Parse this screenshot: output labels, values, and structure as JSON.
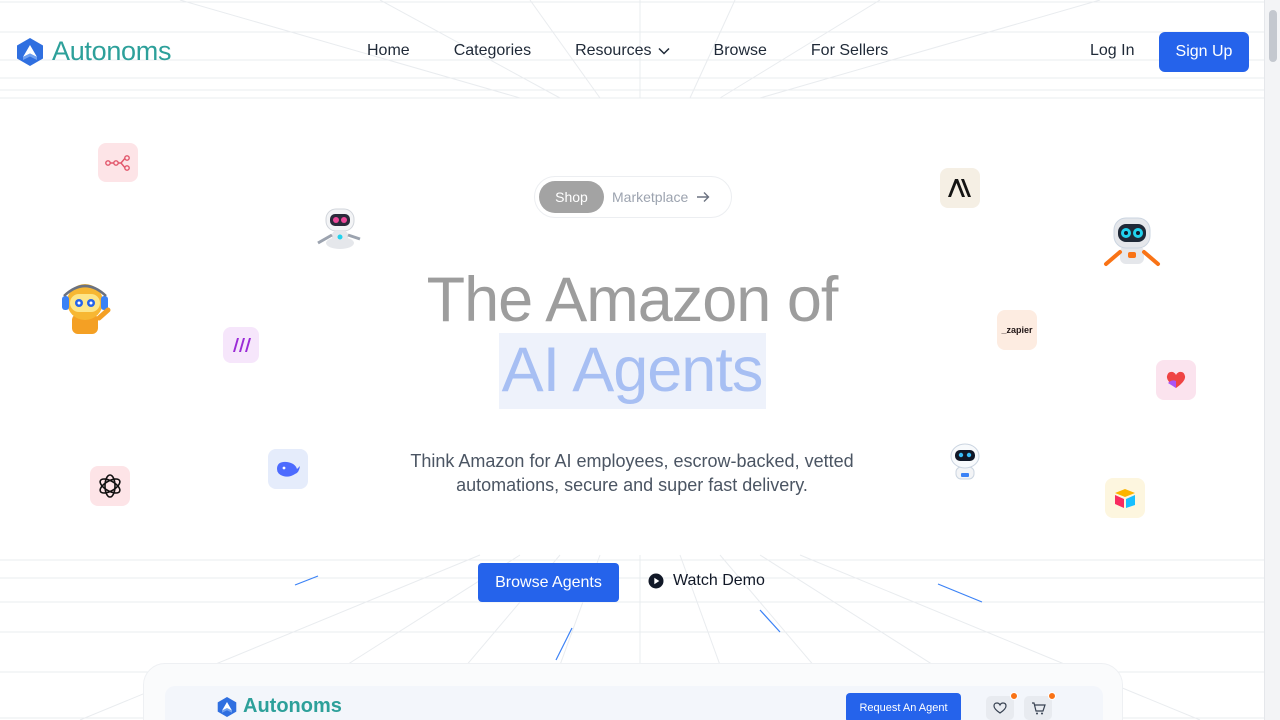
{
  "brand": {
    "name": "Autonoms"
  },
  "nav": {
    "links": [
      "Home",
      "Categories",
      "Resources",
      "Browse",
      "For Sellers"
    ],
    "login": "Log In",
    "signup": "Sign Up"
  },
  "pill": {
    "active": "Shop",
    "other": "Marketplace"
  },
  "hero": {
    "line1": "The Amazon of",
    "line2": "AI Agents",
    "subtitle_line1": "Think Amazon for AI employees, escrow-backed, vetted",
    "subtitle_line2": "automations, secure and super fast delivery."
  },
  "cta": {
    "primary": "Browse Agents",
    "secondary": "Watch Demo"
  },
  "floating_icons": [
    "workflow-icon",
    "robot-pink-icon",
    "robot-yellow-icon",
    "make-icon",
    "openai-icon",
    "deepseek-icon",
    "anthropic-icon",
    "robot-blue-icon",
    "zapier-icon",
    "heart-app-icon",
    "robot-white-icon",
    "airtable-icon"
  ],
  "zapier_text": "_zapier",
  "preview": {
    "brand": "Autonoms",
    "request_button": "Request An Agent",
    "wishlist_count": "0",
    "cart_count": "0"
  },
  "colors": {
    "brand": "#2da09a",
    "primary": "#2563eb",
    "hero_muted": "#9d9d9d",
    "hero_accent": "#a7bff3"
  }
}
